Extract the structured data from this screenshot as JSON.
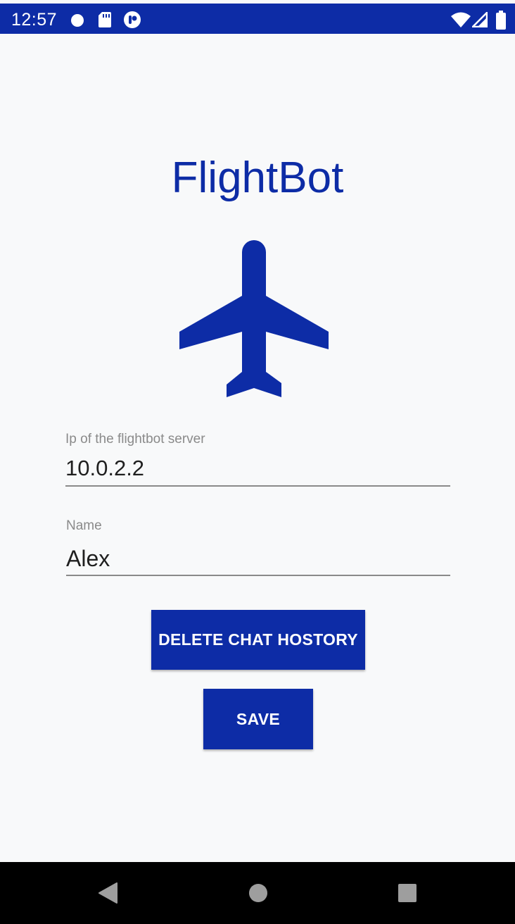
{
  "status_bar": {
    "time": "12:57",
    "icons_left": [
      "notification-dot-icon",
      "sd-card-icon",
      "app-notification-icon"
    ],
    "icons_right": [
      "wifi-icon",
      "cell-signal-icon",
      "battery-icon"
    ],
    "color": "#0d2ca6"
  },
  "main": {
    "title": "FlightBot",
    "logo_icon": "airplane-icon",
    "accent_color": "#0d2ca6",
    "server_field": {
      "label": "Ip of the flightbot server",
      "value": "10.0.2.2"
    },
    "name_field": {
      "label": "Name",
      "value": "Alex"
    },
    "delete_button_label": "DELETE CHAT HOSTORY",
    "save_button_label": "SAVE"
  },
  "nav_bar": {
    "buttons": [
      "back-icon",
      "home-icon",
      "recents-icon"
    ]
  }
}
